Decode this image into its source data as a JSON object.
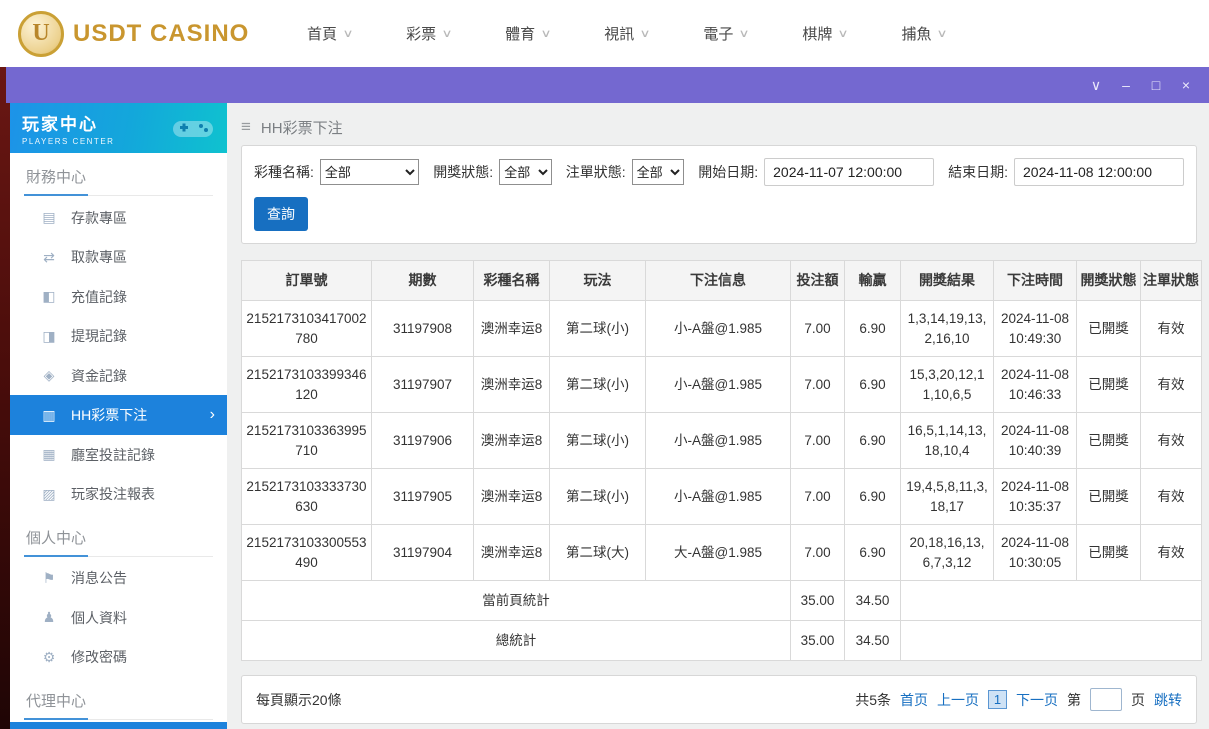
{
  "topnav": {
    "logo_text": "USDT CASINO",
    "items": [
      {
        "label": "首頁"
      },
      {
        "label": "彩票"
      },
      {
        "label": "體育"
      },
      {
        "label": "視訊"
      },
      {
        "label": "電子"
      },
      {
        "label": "棋牌"
      },
      {
        "label": "捕魚"
      }
    ]
  },
  "sidebar": {
    "title": "玩家中心",
    "subtitle": "PLAYERS CENTER",
    "sections": [
      {
        "label": "財務中心",
        "items": [
          {
            "label": "存款專區",
            "icon": "deposit-icon"
          },
          {
            "label": "取款專區",
            "icon": "withdraw-icon"
          },
          {
            "label": "充值記錄",
            "icon": "recharge-records-icon"
          },
          {
            "label": "提現記錄",
            "icon": "cashout-records-icon"
          },
          {
            "label": "資金記錄",
            "icon": "funds-records-icon"
          },
          {
            "label": "HH彩票下注",
            "icon": "lottery-bets-icon"
          },
          {
            "label": "廳室投註記錄",
            "icon": "room-records-icon"
          },
          {
            "label": "玩家投注報表",
            "icon": "report-icon"
          }
        ]
      },
      {
        "label": "個人中心",
        "items": [
          {
            "label": "消息公告",
            "icon": "announcement-icon"
          },
          {
            "label": "個人資料",
            "icon": "person-icon"
          },
          {
            "label": "修改密碼",
            "icon": "gear-icon"
          }
        ]
      },
      {
        "label": "代理中心",
        "items": []
      }
    ]
  },
  "breadcrumb": {
    "title": "HH彩票下注"
  },
  "filters": {
    "lottery_label": "彩種名稱:",
    "lottery_value": "全部",
    "draw_status_label": "開獎狀態:",
    "draw_status_value": "全部",
    "order_status_label": "注單狀態:",
    "order_status_value": "全部",
    "start_label": "開始日期:",
    "start_value": "2024-11-07 12:00:00",
    "end_label": "結束日期:",
    "end_value": "2024-11-08 12:00:00",
    "query_button": "查詢"
  },
  "table": {
    "headers": [
      "訂單號",
      "期數",
      "彩種名稱",
      "玩法",
      "下注信息",
      "投注額",
      "輸贏",
      "開獎結果",
      "下注時間",
      "開獎狀態",
      "注單狀態"
    ],
    "rows": [
      {
        "order": "2152173103417002780",
        "period": "31197908",
        "lottery": "澳洲幸运8",
        "play": "第二球(小)",
        "bet_info": "小-A盤@1.985",
        "amount": "7.00",
        "win": "6.90",
        "result": "1,3,14,19,13,2,16,10",
        "time": "2024-11-08 10:49:30",
        "draw_status": "已開獎",
        "order_status": "有效"
      },
      {
        "order": "2152173103399346120",
        "period": "31197907",
        "lottery": "澳洲幸运8",
        "play": "第二球(小)",
        "bet_info": "小-A盤@1.985",
        "amount": "7.00",
        "win": "6.90",
        "result": "15,3,20,12,11,10,6,5",
        "time": "2024-11-08 10:46:33",
        "draw_status": "已開獎",
        "order_status": "有效"
      },
      {
        "order": "2152173103363995710",
        "period": "31197906",
        "lottery": "澳洲幸运8",
        "play": "第二球(小)",
        "bet_info": "小-A盤@1.985",
        "amount": "7.00",
        "win": "6.90",
        "result": "16,5,1,14,13,18,10,4",
        "time": "2024-11-08 10:40:39",
        "draw_status": "已開獎",
        "order_status": "有效"
      },
      {
        "order": "2152173103333730630",
        "period": "31197905",
        "lottery": "澳洲幸运8",
        "play": "第二球(小)",
        "bet_info": "小-A盤@1.985",
        "amount": "7.00",
        "win": "6.90",
        "result": "19,4,5,8,11,3,18,17",
        "time": "2024-11-08 10:35:37",
        "draw_status": "已開獎",
        "order_status": "有效"
      },
      {
        "order": "2152173103300553490",
        "period": "31197904",
        "lottery": "澳洲幸运8",
        "play": "第二球(大)",
        "bet_info": "大-A盤@1.985",
        "amount": "7.00",
        "win": "6.90",
        "result": "20,18,16,13,6,7,3,12",
        "time": "2024-11-08 10:30:05",
        "draw_status": "已開獎",
        "order_status": "有效"
      }
    ],
    "page_total": {
      "label": "當前頁統計",
      "amount": "35.00",
      "win": "34.50"
    },
    "grand_total": {
      "label": "總統計",
      "amount": "35.00",
      "win": "34.50"
    }
  },
  "footer": {
    "per_page": "每頁顯示20條",
    "total_label": "共5条",
    "first": "首页",
    "prev": "上一页",
    "current": "1",
    "next": "下一页",
    "jump_prefix": "第",
    "jump_suffix": "页",
    "jump_action": "跳转"
  },
  "colors": {
    "titlebar_purple": "#7468d0",
    "accent_blue": "#1d82dc",
    "link_blue": "#176fc1",
    "logo_gold": "#c9962f"
  }
}
